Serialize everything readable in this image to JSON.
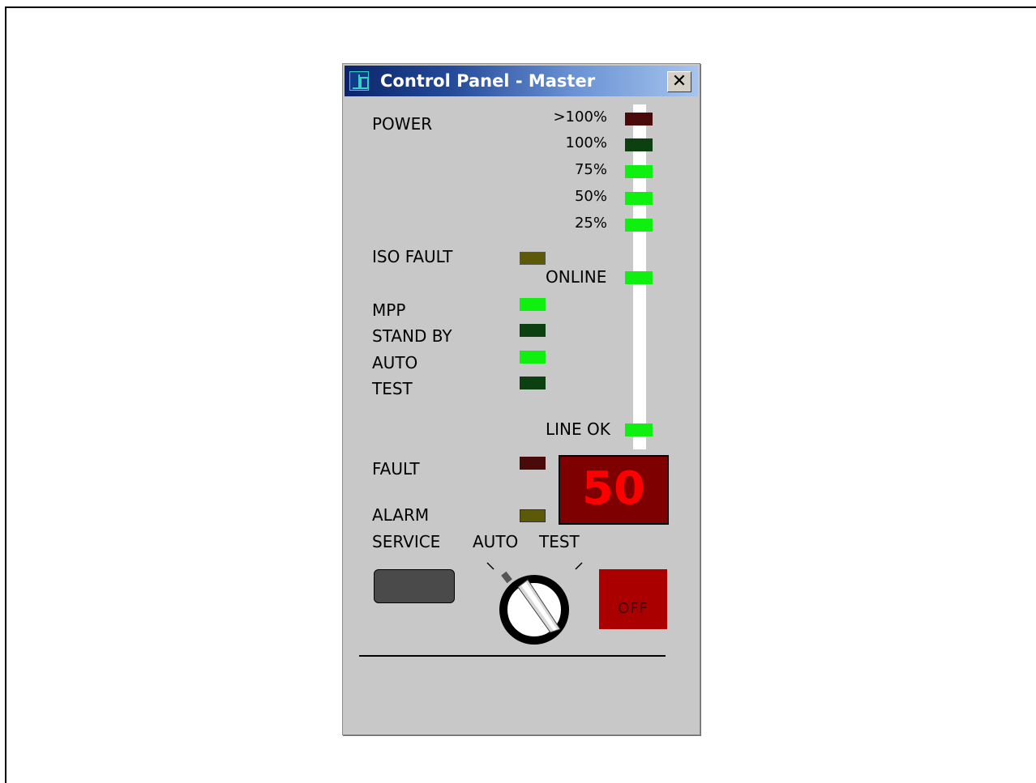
{
  "window": {
    "title": "Control Panel - Master",
    "close_glyph": "✕"
  },
  "power": {
    "label": "POWER",
    "levels": [
      {
        "label": ">100%",
        "color": "#4a0a0a"
      },
      {
        "label": "100%",
        "color": "#0c4010"
      },
      {
        "label": "75%",
        "color": "#10f010"
      },
      {
        "label": "50%",
        "color": "#10f010"
      },
      {
        "label": "25%",
        "color": "#10f010"
      }
    ]
  },
  "indicators": {
    "iso_fault": {
      "label": "ISO FAULT",
      "color": "#5c5a08"
    },
    "online": {
      "label": "ONLINE",
      "color": "#10f010"
    },
    "mpp": {
      "label": "MPP",
      "color": "#10f010"
    },
    "stand_by": {
      "label": "STAND BY",
      "color": "#0c4010"
    },
    "auto": {
      "label": "AUTO",
      "color": "#10f010"
    },
    "test": {
      "label": "TEST",
      "color": "#0c4010"
    },
    "line_ok": {
      "label": "LINE OK",
      "color": "#10f010"
    },
    "fault": {
      "label": "FAULT",
      "color": "#4a0a0a"
    },
    "alarm": {
      "label": "ALARM",
      "color": "#5c5a08"
    }
  },
  "display": {
    "value": "50"
  },
  "controls": {
    "service_label": "SERVICE",
    "mode_auto_label": "AUTO",
    "mode_test_label": "TEST",
    "off_label": "OFF"
  }
}
